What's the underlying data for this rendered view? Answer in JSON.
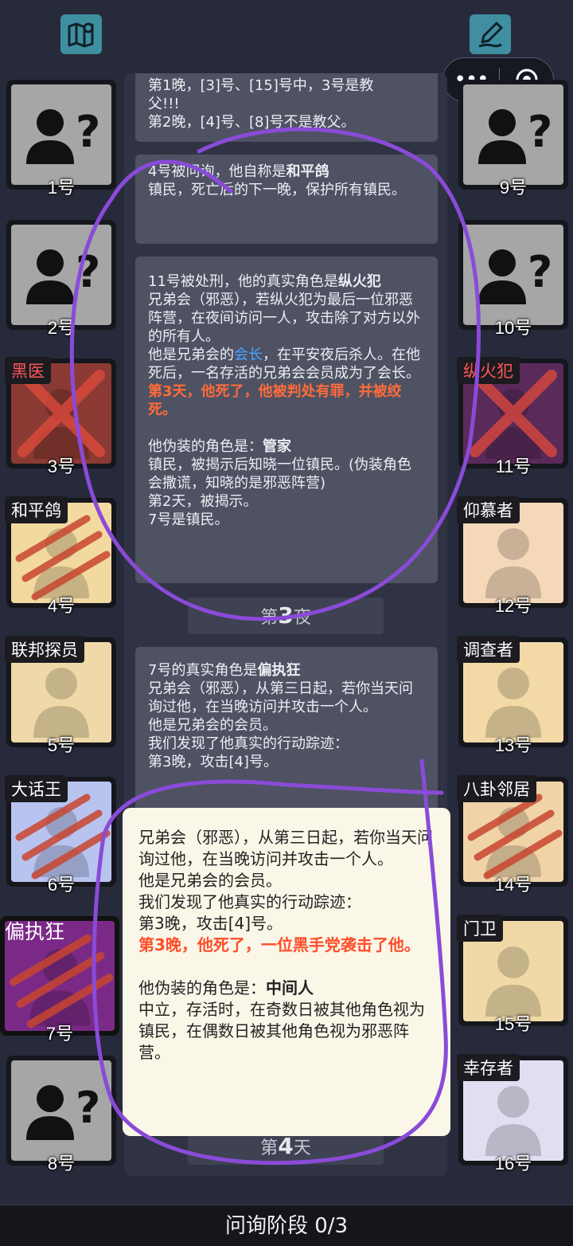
{
  "top": {
    "map_icon": "map-icon",
    "edit_icon": "edit-icon",
    "capsule_more": "•••"
  },
  "players": [
    {
      "num": "1号",
      "tag": "",
      "state": "unknown",
      "bg": "#a6a6a6"
    },
    {
      "num": "2号",
      "tag": "",
      "state": "unknown",
      "bg": "#a6a6a6"
    },
    {
      "num": "3号",
      "tag": "黑医",
      "tag_red": true,
      "state": "dead",
      "bg": "#8a3a33"
    },
    {
      "num": "4号",
      "tag": "和平鸽",
      "state": "clawed",
      "bg": "#f2d9a0"
    },
    {
      "num": "5号",
      "tag": "联邦探员",
      "state": "alive",
      "bg": "#f0d9a8"
    },
    {
      "num": "6号",
      "tag": "大话王",
      "state": "clawed",
      "bg": "#b9c3ef"
    },
    {
      "num": "7号",
      "tag": "偏执狂",
      "state": "clawed",
      "bg": "#7a2a86"
    },
    {
      "num": "8号",
      "tag": "",
      "state": "unknown",
      "bg": "#a6a6a6"
    },
    {
      "num": "9号",
      "tag": "",
      "state": "unknown",
      "bg": "#a6a6a6"
    },
    {
      "num": "10号",
      "tag": "",
      "state": "unknown",
      "bg": "#a6a6a6"
    },
    {
      "num": "11号",
      "tag": "纵火犯",
      "tag_red": true,
      "state": "dead",
      "bg": "#5a2a5a"
    },
    {
      "num": "12号",
      "tag": "仰慕者",
      "state": "alive",
      "bg": "#f5d8b8"
    },
    {
      "num": "13号",
      "tag": "调查者",
      "state": "alive",
      "bg": "#f2d9a6"
    },
    {
      "num": "14号",
      "tag": "八卦邻居",
      "state": "clawed",
      "bg": "#f0d4a8"
    },
    {
      "num": "15号",
      "tag": "门卫",
      "state": "alive",
      "bg": "#f0d9a6"
    },
    {
      "num": "16号",
      "tag": "幸存者",
      "state": "alive",
      "bg": "#e2def2"
    }
  ],
  "feed": {
    "msg0": {
      "line1": "第1晚，[3]号、[15]号中，3号是教",
      "line2": "父!!!",
      "line3": "第2晚，[4]号、[8]号不是教父。"
    },
    "msg1": {
      "pre": "4号被问询，他自称是",
      "role": "和平鸽",
      "desc": "镇民，死亡后的下一晚，保护所有镇民。"
    },
    "msg2": {
      "pre": "11号被处刑，他的真实角色是",
      "role": "纵火犯",
      "desc": "兄弟会（邪恶），若纵火犯为最后一位邪恶阵营，在夜间访问一人，攻击除了对方以外的所有人。",
      "leader_pre": "他是兄弟会的",
      "leader": "会长",
      "leader_post": "，在平安夜后杀人。在他死后，一名存活的兄弟会会员成为了会长。",
      "death": "第3天，他死了，他被判处有罪，并被绞死。",
      "fake_pre": "他伪装的角色是：",
      "fake_role": "管家",
      "fake_desc": "镇民，被揭示后知晓一位镇民。(伪装角色会撒谎，知晓的是邪恶阵营)",
      "fake_day": "第2天，被揭示。",
      "fake_info": "7号是镇民。"
    },
    "phase_night": {
      "pre": "第",
      "num": "3",
      "post": "夜"
    },
    "msg3": {
      "pre": "7号的真实角色是",
      "role": "偏执狂",
      "desc": "兄弟会（邪恶），从第三日起，若你当天问询过他，在当晚访问并攻击一个人。",
      "member": "他是兄弟会的会员。",
      "trace": "我们发现了他真实的行动踪迹：",
      "night": "第3晚，攻击[4]号。"
    },
    "phase_day": {
      "pre": "第",
      "num": "4",
      "post": "天"
    }
  },
  "tooltip": {
    "desc": "兄弟会（邪恶），从第三日起，若你当天问询过他，在当晚访问并攻击一个人。",
    "member": "他是兄弟会的会员。",
    "trace": "我们发现了他真实的行动踪迹：",
    "night": "第3晚，攻击[4]号。",
    "death": "第3晚，他死了，一位黑手党袭击了他。",
    "fake_pre": "他伪装的角色是：",
    "fake_role": "中间人",
    "fake_desc": "中立，存活时，在奇数日被其他角色视为镇民，在偶数日被其他角色视为邪恶阵营。"
  },
  "bottom": {
    "label": "问询阶段 0/3"
  },
  "colors": {
    "red_text": "#ff6b3a",
    "blue_text": "#4aa4ff",
    "annotation": "#8a4bd8",
    "bg": "#262a3a"
  }
}
